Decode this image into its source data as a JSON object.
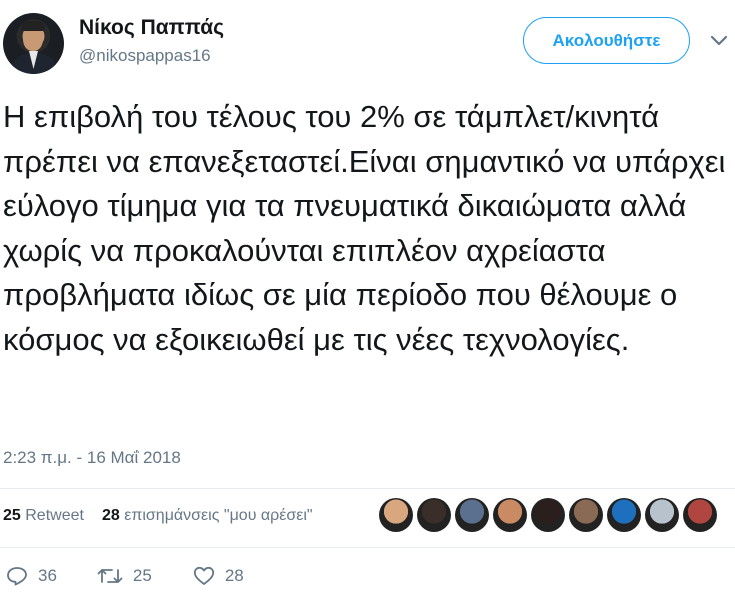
{
  "author": {
    "name": "Νίκος Παππάς",
    "handle": "@nikospappas16"
  },
  "follow_label": "Ακολουθήστε",
  "tweet_text": "Η επιβολή του τέλους του 2% σε τάμπλετ/κινητά πρέπει να επανεξεταστεί.Είναι σημαντικό να υπάρχει εύλογο τίμημα για τα πνευματικά δικαιώματα αλλά χωρίς να προκαλούνται επιπλέον αχρείαστα προβλήματα ιδίως σε μία περίοδο που θέλουμε ο κόσμος να εξοικειωθεί με τις νέες τεχνολογίες.",
  "timestamp": "2:23 π.μ. - 16 Μαΐ 2018",
  "stats": {
    "retweets_count": "25",
    "retweets_label": "Retweet",
    "likes_count": "28",
    "likes_label": "επισημάνσεις \"μου αρέσει\""
  },
  "likers": [
    "#d8a67f",
    "#3a2f28",
    "#5b6f8e",
    "#c98a64",
    "#2a1f1c",
    "#8a6a55",
    "#1f6fbf",
    "#b8c2cc",
    "#b0463f"
  ],
  "actions": {
    "reply_count": "36",
    "retweet_count": "25",
    "like_count": "28"
  },
  "colors": {
    "accent": "#1da1f2",
    "muted": "#657786",
    "text": "#14171a"
  }
}
